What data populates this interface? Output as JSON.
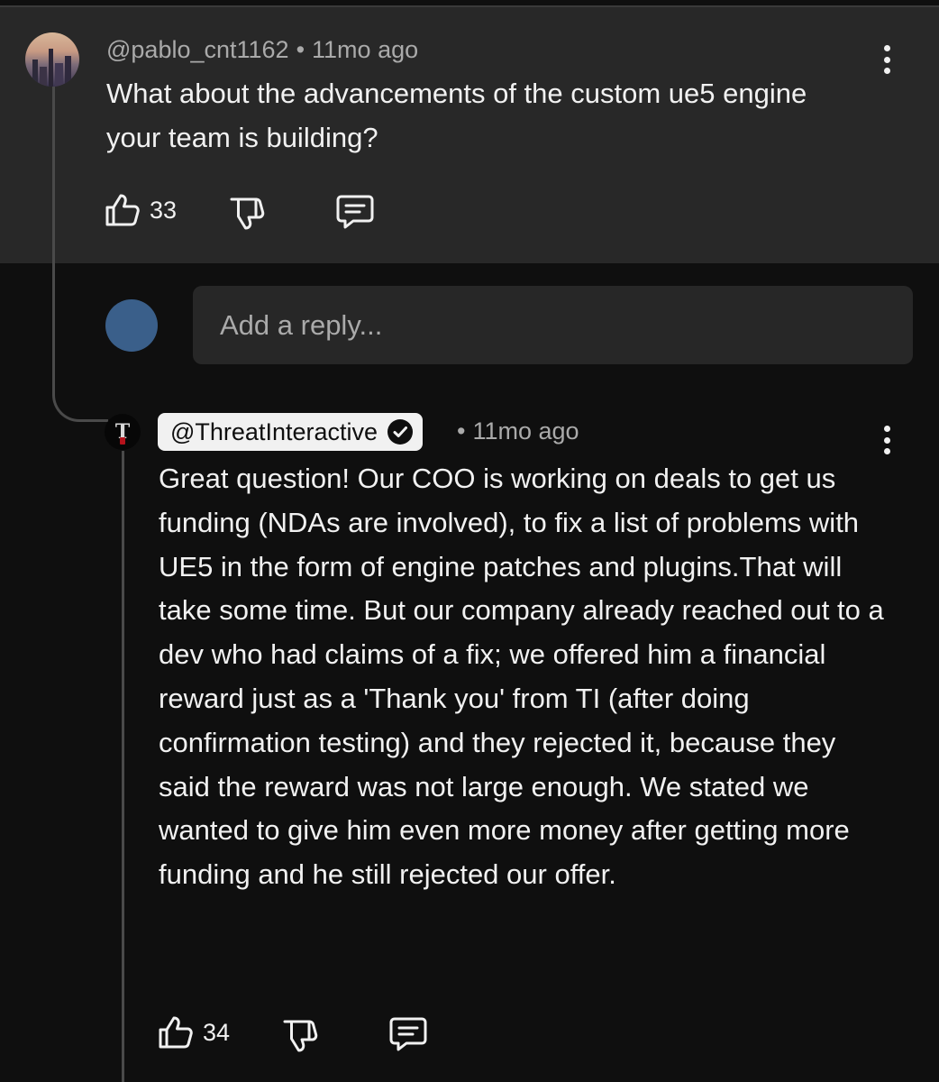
{
  "parent_comment": {
    "author": "@pablo_cnt1162",
    "separator": "•",
    "time": "11mo ago",
    "text": "What about the advancements of the custom ue5 engine your team is building?",
    "likes": "33"
  },
  "reply_input": {
    "placeholder": "Add a reply..."
  },
  "reply_comment": {
    "author": "@ThreatInteractive",
    "avatar_text": "T",
    "separator": "•",
    "time": "11mo ago",
    "text": "Great question! Our COO is working on deals to get us funding (NDAs are involved), to fix a list of problems with UE5 in the form of engine patches and plugins.That will take some time. But our company already reached out to a dev who had claims of a fix; we offered him a financial reward just as a 'Thank you' from TI (after doing confirmation testing) and they rejected it, because they said the reward was not large enough. We stated we wanted to give him even more money after getting more funding and he still rejected our offer.",
    "likes": "34",
    "verified": true
  },
  "icons": {
    "like": "thumbs-up-icon",
    "dislike": "thumbs-down-icon",
    "reply": "comment-icon",
    "more": "more-vertical-icon",
    "verified": "verified-check-icon"
  },
  "colors": {
    "background": "#0f0f0f",
    "highlight_background": "#282828",
    "text_primary": "#f1f1f1",
    "text_secondary": "#aaaaaa",
    "input_background": "#272727",
    "avatar_user": "#3a5f8a"
  }
}
